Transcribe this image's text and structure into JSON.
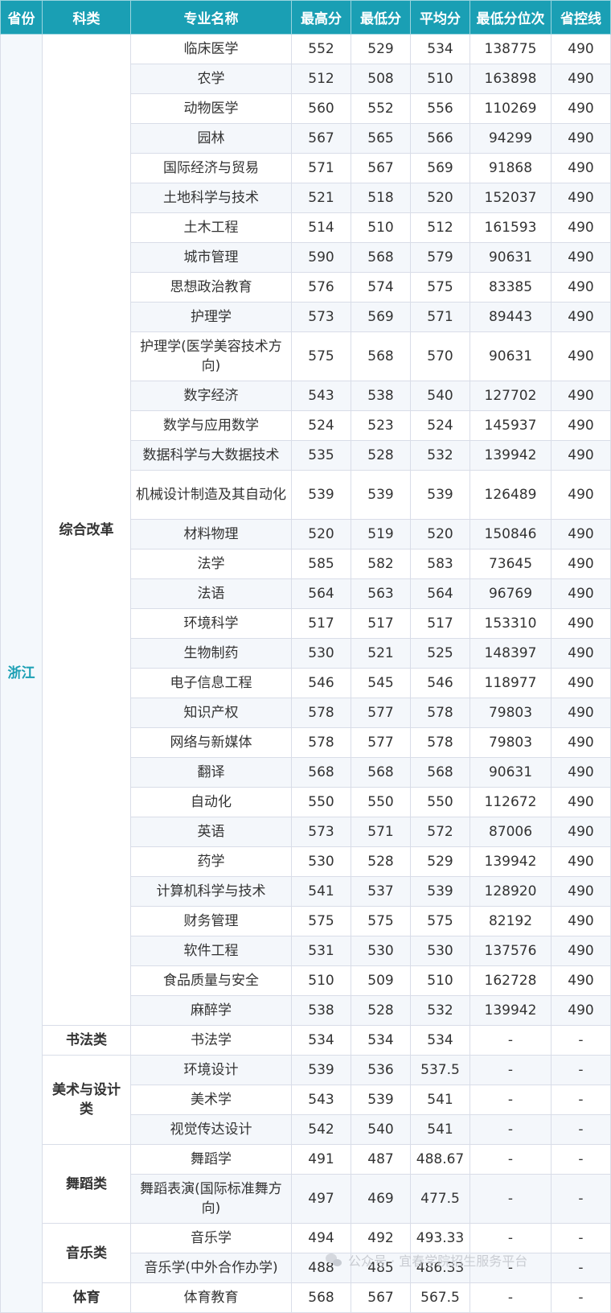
{
  "headers": [
    "省份",
    "科类",
    "专业名称",
    "最高分",
    "最低分",
    "平均分",
    "最低分位次",
    "省控线"
  ],
  "province": "浙江",
  "groups": [
    {
      "category": "综合改革",
      "rows": [
        [
          "临床医学",
          "552",
          "529",
          "534",
          "138775",
          "490"
        ],
        [
          "农学",
          "512",
          "508",
          "510",
          "163898",
          "490"
        ],
        [
          "动物医学",
          "560",
          "552",
          "556",
          "110269",
          "490"
        ],
        [
          "园林",
          "567",
          "565",
          "566",
          "94299",
          "490"
        ],
        [
          "国际经济与贸易",
          "571",
          "567",
          "569",
          "91868",
          "490"
        ],
        [
          "土地科学与技术",
          "521",
          "518",
          "520",
          "152037",
          "490"
        ],
        [
          "土木工程",
          "514",
          "510",
          "512",
          "161593",
          "490"
        ],
        [
          "城市管理",
          "590",
          "568",
          "579",
          "90631",
          "490"
        ],
        [
          "思想政治教育",
          "576",
          "574",
          "575",
          "83385",
          "490"
        ],
        [
          "护理学",
          "573",
          "569",
          "571",
          "89443",
          "490"
        ],
        [
          "护理学(医学美容技术方向)",
          "575",
          "568",
          "570",
          "90631",
          "490"
        ],
        [
          "数字经济",
          "543",
          "538",
          "540",
          "127702",
          "490"
        ],
        [
          "数学与应用数学",
          "524",
          "523",
          "524",
          "145937",
          "490"
        ],
        [
          "数据科学与大数据技术",
          "535",
          "528",
          "532",
          "139942",
          "490"
        ],
        [
          "机械设计制造及其自动化",
          "539",
          "539",
          "539",
          "126489",
          "490"
        ],
        [
          "材料物理",
          "520",
          "519",
          "520",
          "150846",
          "490"
        ],
        [
          "法学",
          "585",
          "582",
          "583",
          "73645",
          "490"
        ],
        [
          "法语",
          "564",
          "563",
          "564",
          "96769",
          "490"
        ],
        [
          "环境科学",
          "517",
          "517",
          "517",
          "153310",
          "490"
        ],
        [
          "生物制药",
          "530",
          "521",
          "525",
          "148397",
          "490"
        ],
        [
          "电子信息工程",
          "546",
          "545",
          "546",
          "118977",
          "490"
        ],
        [
          "知识产权",
          "578",
          "577",
          "578",
          "79803",
          "490"
        ],
        [
          "网络与新媒体",
          "578",
          "577",
          "578",
          "79803",
          "490"
        ],
        [
          "翻译",
          "568",
          "568",
          "568",
          "90631",
          "490"
        ],
        [
          "自动化",
          "550",
          "550",
          "550",
          "112672",
          "490"
        ],
        [
          "英语",
          "573",
          "571",
          "572",
          "87006",
          "490"
        ],
        [
          "药学",
          "530",
          "528",
          "529",
          "139942",
          "490"
        ],
        [
          "计算机科学与技术",
          "541",
          "537",
          "539",
          "128920",
          "490"
        ],
        [
          "财务管理",
          "575",
          "575",
          "575",
          "82192",
          "490"
        ],
        [
          "软件工程",
          "531",
          "530",
          "530",
          "137576",
          "490"
        ],
        [
          "食品质量与安全",
          "510",
          "509",
          "510",
          "162728",
          "490"
        ],
        [
          "麻醉学",
          "538",
          "528",
          "532",
          "139942",
          "490"
        ]
      ]
    },
    {
      "category": "书法类",
      "rows": [
        [
          "书法学",
          "534",
          "534",
          "534",
          "-",
          "-"
        ]
      ]
    },
    {
      "category": "美术与设计类",
      "rows": [
        [
          "环境设计",
          "539",
          "536",
          "537.5",
          "-",
          "-"
        ],
        [
          "美术学",
          "543",
          "539",
          "541",
          "-",
          "-"
        ],
        [
          "视觉传达设计",
          "542",
          "540",
          "541",
          "-",
          "-"
        ]
      ]
    },
    {
      "category": "舞蹈类",
      "rows": [
        [
          "舞蹈学",
          "491",
          "487",
          "488.67",
          "-",
          "-"
        ],
        [
          "舞蹈表演(国际标准舞方向)",
          "497",
          "469",
          "477.5",
          "-",
          "-"
        ]
      ]
    },
    {
      "category": "音乐类",
      "rows": [
        [
          "音乐学",
          "494",
          "492",
          "493.33",
          "-",
          "-"
        ],
        [
          "音乐学(中外合作办学)",
          "488",
          "485",
          "486.33",
          "-",
          "-"
        ]
      ]
    },
    {
      "category": "体育",
      "rows": [
        [
          "体育教育",
          "568",
          "567",
          "567.5",
          "-",
          "-"
        ]
      ]
    }
  ],
  "watermark": "公众号 · 宜春学院招生服务平台"
}
